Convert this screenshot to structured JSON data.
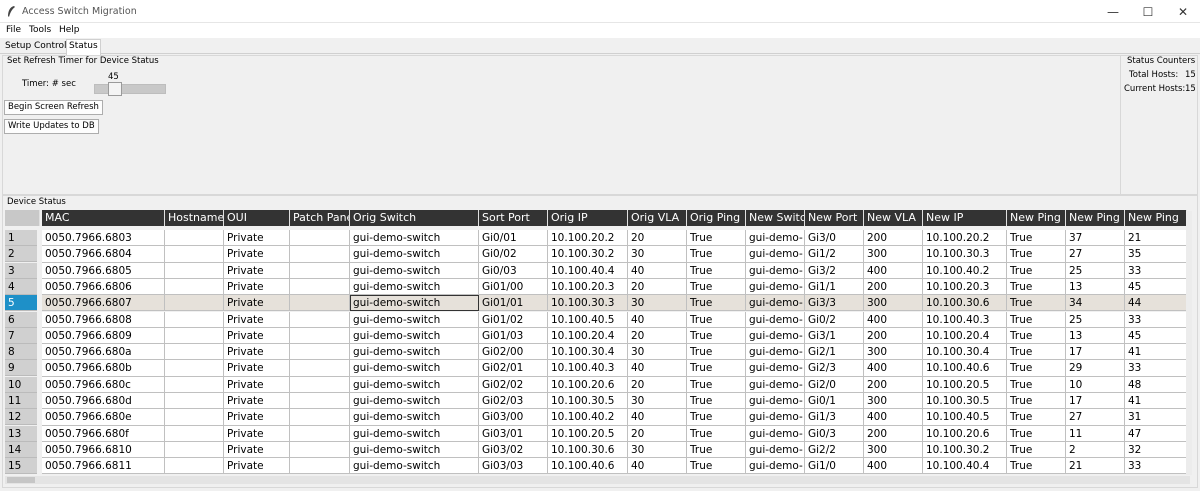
{
  "window": {
    "title": "Access Switch Migration",
    "minimize": "—",
    "maximize": "☐",
    "close": "✕"
  },
  "menu": {
    "file": "File",
    "tools": "Tools",
    "help": "Help"
  },
  "tabs": {
    "setup": "Setup",
    "control": "Control",
    "status": "Status"
  },
  "refresh": {
    "group_label": "Set Refresh Timer for Device Status",
    "timer_label": "Timer: # sec",
    "timer_value": "45",
    "begin_button": "Begin Screen Refresh",
    "write_button": "Write Updates to DB"
  },
  "counters": {
    "group_label": "Status Counters",
    "total_label": "Total Hosts:",
    "total_value": "15",
    "current_label": "Current Hosts:",
    "current_value": "15"
  },
  "device_status": {
    "group_label": "Device Status",
    "columns": [
      "MAC",
      "Hostname",
      "OUI",
      "Patch Pane",
      "Orig Switch",
      "Sort Port",
      "Orig IP",
      "Orig VLA",
      "Orig Ping",
      "New Switc",
      "New Port",
      "New VLA",
      "New IP",
      "New Ping",
      "New Ping",
      "New Ping"
    ],
    "selected_row": 5,
    "rows": [
      {
        "num": "1",
        "cells": [
          "0050.7966.6803",
          "",
          "Private",
          "",
          "gui-demo-switch",
          "Gi0/01",
          "10.100.20.2",
          "20",
          "True",
          "gui-demo-",
          "Gi3/0",
          "200",
          "10.100.20.2",
          "True",
          "37",
          "21"
        ]
      },
      {
        "num": "2",
        "cells": [
          "0050.7966.6804",
          "",
          "Private",
          "",
          "gui-demo-switch",
          "Gi0/02",
          "10.100.30.2",
          "30",
          "True",
          "gui-demo-",
          "Gi1/2",
          "300",
          "10.100.30.3",
          "True",
          "27",
          "35"
        ]
      },
      {
        "num": "3",
        "cells": [
          "0050.7966.6805",
          "",
          "Private",
          "",
          "gui-demo-switch",
          "Gi0/03",
          "10.100.40.4",
          "40",
          "True",
          "gui-demo-",
          "Gi3/2",
          "400",
          "10.100.40.2",
          "True",
          "25",
          "33"
        ]
      },
      {
        "num": "4",
        "cells": [
          "0050.7966.6806",
          "",
          "Private",
          "",
          "gui-demo-switch",
          "Gi01/00",
          "10.100.20.3",
          "20",
          "True",
          "gui-demo-",
          "Gi1/1",
          "200",
          "10.100.20.3",
          "True",
          "13",
          "45"
        ]
      },
      {
        "num": "5",
        "cells": [
          "0050.7966.6807",
          "",
          "Private",
          "",
          "gui-demo-switch",
          "Gi01/01",
          "10.100.30.3",
          "30",
          "True",
          "gui-demo-",
          "Gi3/3",
          "300",
          "10.100.30.6",
          "True",
          "34",
          "44"
        ]
      },
      {
        "num": "6",
        "cells": [
          "0050.7966.6808",
          "",
          "Private",
          "",
          "gui-demo-switch",
          "Gi01/02",
          "10.100.40.5",
          "40",
          "True",
          "gui-demo-",
          "Gi0/2",
          "400",
          "10.100.40.3",
          "True",
          "25",
          "33"
        ]
      },
      {
        "num": "7",
        "cells": [
          "0050.7966.6809",
          "",
          "Private",
          "",
          "gui-demo-switch",
          "Gi01/03",
          "10.100.20.4",
          "20",
          "True",
          "gui-demo-",
          "Gi3/1",
          "200",
          "10.100.20.4",
          "True",
          "13",
          "45"
        ]
      },
      {
        "num": "8",
        "cells": [
          "0050.7966.680a",
          "",
          "Private",
          "",
          "gui-demo-switch",
          "Gi02/00",
          "10.100.30.4",
          "30",
          "True",
          "gui-demo-",
          "Gi2/1",
          "300",
          "10.100.30.4",
          "True",
          "17",
          "41"
        ]
      },
      {
        "num": "9",
        "cells": [
          "0050.7966.680b",
          "",
          "Private",
          "",
          "gui-demo-switch",
          "Gi02/01",
          "10.100.40.3",
          "40",
          "True",
          "gui-demo-",
          "Gi2/3",
          "400",
          "10.100.40.6",
          "True",
          "29",
          "33"
        ]
      },
      {
        "num": "10",
        "cells": [
          "0050.7966.680c",
          "",
          "Private",
          "",
          "gui-demo-switch",
          "Gi02/02",
          "10.100.20.6",
          "20",
          "True",
          "gui-demo-",
          "Gi2/0",
          "200",
          "10.100.20.5",
          "True",
          "10",
          "48"
        ]
      },
      {
        "num": "11",
        "cells": [
          "0050.7966.680d",
          "",
          "Private",
          "",
          "gui-demo-switch",
          "Gi02/03",
          "10.100.30.5",
          "30",
          "True",
          "gui-demo-",
          "Gi0/1",
          "300",
          "10.100.30.5",
          "True",
          "17",
          "41"
        ]
      },
      {
        "num": "12",
        "cells": [
          "0050.7966.680e",
          "",
          "Private",
          "",
          "gui-demo-switch",
          "Gi03/00",
          "10.100.40.2",
          "40",
          "True",
          "gui-demo-",
          "Gi1/3",
          "400",
          "10.100.40.5",
          "True",
          "27",
          "31"
        ]
      },
      {
        "num": "13",
        "cells": [
          "0050.7966.680f",
          "",
          "Private",
          "",
          "gui-demo-switch",
          "Gi03/01",
          "10.100.20.5",
          "20",
          "True",
          "gui-demo-",
          "Gi0/3",
          "200",
          "10.100.20.6",
          "True",
          "11",
          "47"
        ]
      },
      {
        "num": "14",
        "cells": [
          "0050.7966.6810",
          "",
          "Private",
          "",
          "gui-demo-switch",
          "Gi03/02",
          "10.100.30.6",
          "30",
          "True",
          "gui-demo-",
          "Gi2/2",
          "300",
          "10.100.30.2",
          "True",
          "2",
          "32"
        ]
      },
      {
        "num": "15",
        "cells": [
          "0050.7966.6811",
          "",
          "Private",
          "",
          "gui-demo-switch",
          "Gi03/03",
          "10.100.40.6",
          "40",
          "True",
          "gui-demo-",
          "Gi1/0",
          "400",
          "10.100.40.4",
          "True",
          "21",
          "33"
        ]
      }
    ]
  }
}
